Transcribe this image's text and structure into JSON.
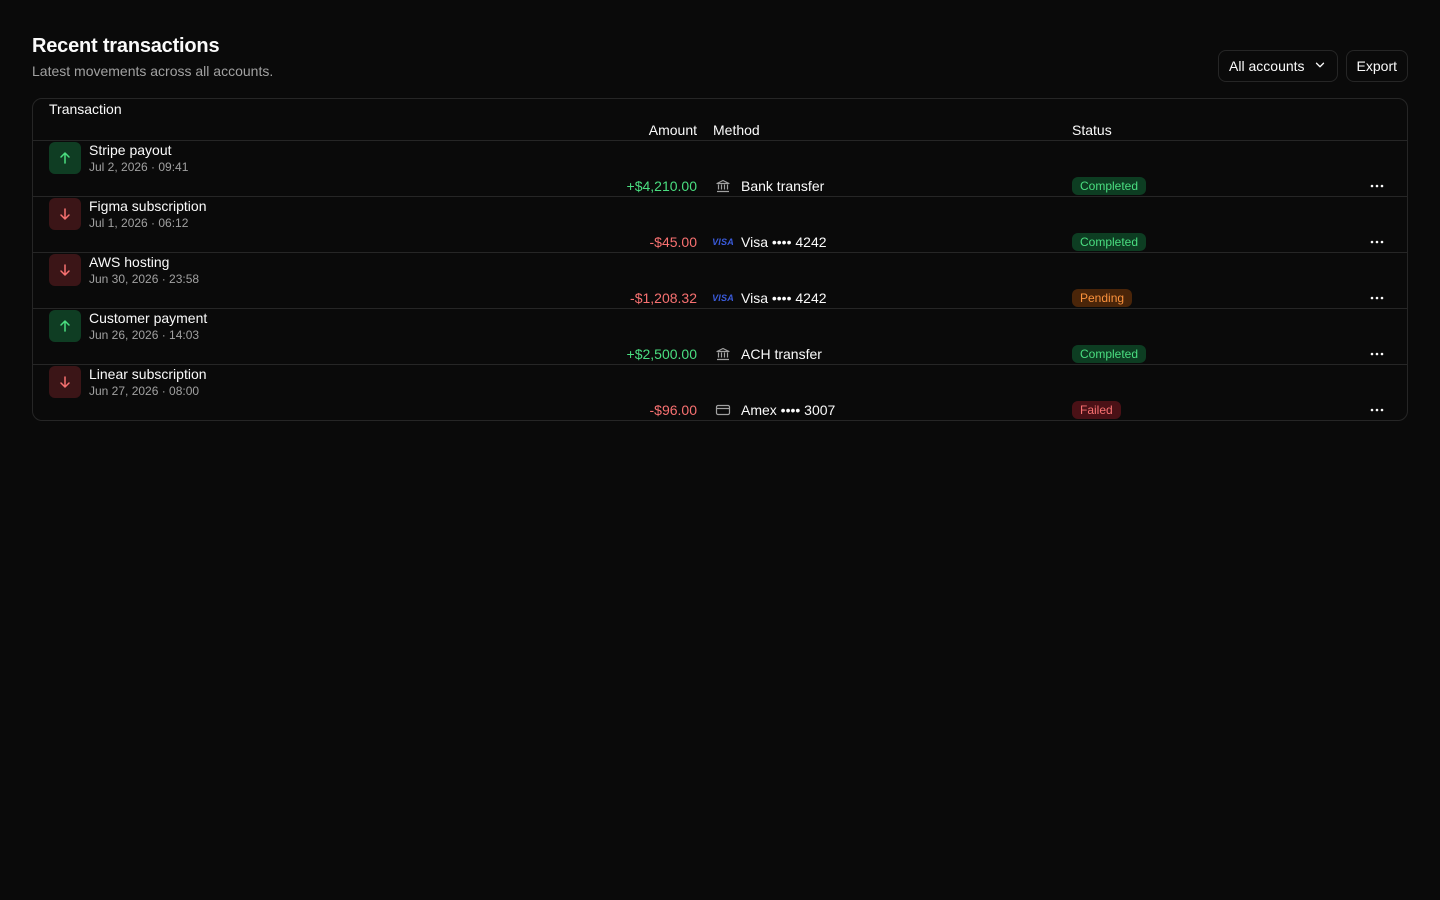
{
  "header": {
    "title": "Recent transactions",
    "subtitle": "Latest movements across all accounts.",
    "filter_label": "All accounts",
    "export_label": "Export"
  },
  "columns": {
    "transaction": "Transaction",
    "amount": "Amount",
    "method": "Method",
    "status": "Status"
  },
  "rows": [
    {
      "name": "Stripe payout",
      "date": "Jul 2, 2026 · 09:41",
      "amount": "+$4,210.00",
      "direction": "in",
      "method": "Bank transfer",
      "method_icon": "bank-icon",
      "status": "Completed"
    },
    {
      "name": "Figma subscription",
      "date": "Jul 1, 2026 · 06:12",
      "amount": "-$45.00",
      "direction": "out",
      "method": "Visa •••• 4242",
      "method_icon": "visa-icon",
      "status": "Completed"
    },
    {
      "name": "AWS hosting",
      "date": "Jun 30, 2026 · 23:58",
      "amount": "-$1,208.32",
      "direction": "out",
      "method": "Visa •••• 4242",
      "method_icon": "visa-icon",
      "status": "Pending"
    },
    {
      "name": "Customer payment",
      "date": "Jun 26, 2026 · 14:03",
      "amount": "+$2,500.00",
      "direction": "in",
      "method": "ACH transfer",
      "method_icon": "bank-icon",
      "status": "Completed"
    },
    {
      "name": "Linear subscription",
      "date": "Jun 27, 2026 · 08:00",
      "amount": "-$96.00",
      "direction": "out",
      "method": "Amex •••• 3007",
      "method_icon": "credit-card-icon",
      "status": "Failed"
    }
  ],
  "icons": {
    "visa_text": "VISA"
  },
  "colors": {
    "positive": "#4ade80",
    "negative": "#f87171",
    "pending": "#fb923c",
    "background": "#0a0a0a",
    "border": "#262626"
  }
}
